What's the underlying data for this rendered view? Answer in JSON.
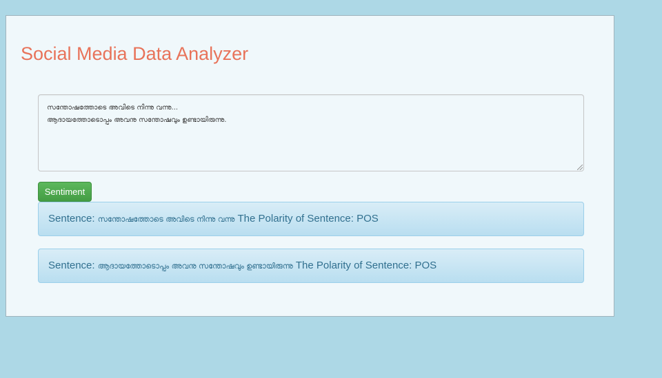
{
  "header": {
    "title": "Social Media Data Analyzer"
  },
  "input": {
    "lines": [
      "സന്തോഷത്തോടെ അവിടെ നിന്നു വന്നു...",
      "ആദായത്തോടൊപ്പം അവനു സന്തോഷവും ഉണ്ടായിരുന്നു."
    ]
  },
  "actions": {
    "sentiment_label": "Sentiment"
  },
  "results": [
    {
      "prefix": "Sentence:",
      "sentence": "സന്തോഷത്തോടെ അവിടെ നിന്നു വന്നു",
      "polarity_label": "The Polarity of Sentence:",
      "polarity": "POS"
    },
    {
      "prefix": "Sentence:",
      "sentence": "ആദായത്തോടൊപ്പം അവനു സന്തോഷവും ഉണ്ടായിരുന്നു",
      "polarity_label": "The Polarity of Sentence:",
      "polarity": "POS"
    }
  ],
  "colors": {
    "page_background": "#add8e6",
    "panel_background": "#f0f8fb",
    "title": "#e8735a",
    "button": "#5cb85c",
    "result_text": "#31708f",
    "result_background": "#d9edf7"
  }
}
